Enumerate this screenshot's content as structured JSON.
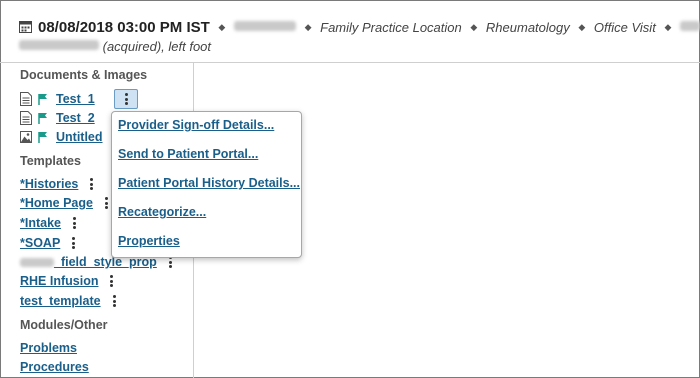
{
  "header": {
    "date_time": "08/08/2018 03:00 PM IST",
    "provider_name": "Needles, A",
    "location": "Family Practice Location",
    "specialty": "Rheumatology",
    "visit_type": "Office Visit",
    "encounter_number": "873",
    "diagnosis_blurred": "Hallux valgus",
    "diagnosis_suffix": "(acquired), left foot",
    "icons": [
      "calendar-icon",
      "lock-icon"
    ]
  },
  "sidebar": {
    "documents_heading": "Documents & Images",
    "documents": [
      {
        "label": "Test_1",
        "icon": "document-icon"
      },
      {
        "label": "Test_2",
        "icon": "document-icon"
      },
      {
        "label": "Untitled",
        "icon": "image-icon"
      }
    ],
    "templates_heading": "Templates",
    "templates": [
      {
        "label": "*Histories"
      },
      {
        "label": "*Home Page"
      },
      {
        "label": "*Intake"
      },
      {
        "label": "*SOAP"
      },
      {
        "label_blurred": "Gout",
        "label_suffix": "_field_style_prop"
      },
      {
        "label": "RHE Infusion"
      },
      {
        "label": "test_template"
      }
    ],
    "modules_heading": "Modules/Other",
    "modules": [
      {
        "label": "Problems"
      },
      {
        "label": "Procedures"
      }
    ]
  },
  "context_menu": {
    "items": [
      "Provider Sign-off Details...",
      "Send to Patient Portal...",
      "Patient Portal History Details...",
      "Recategorize...",
      "Properties"
    ]
  },
  "colors": {
    "link": "#1a5f8a",
    "flag": "#1a9a8a",
    "active_menu_button": "#cfe2f3"
  }
}
